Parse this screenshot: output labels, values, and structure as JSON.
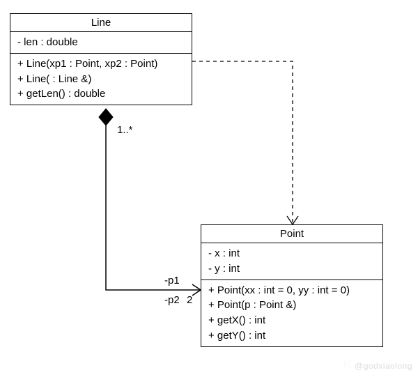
{
  "classes": {
    "line": {
      "name": "Line",
      "attributes": [
        "- len : double"
      ],
      "operations": [
        "+ Line(xp1 : Point, xp2 : Point)",
        "+ Line( : Line &)",
        "+ getLen() : double"
      ]
    },
    "point": {
      "name": "Point",
      "attributes": [
        "- x : int",
        "- y : int"
      ],
      "operations": [
        "+ Point(xx : int = 0, yy : int = 0)",
        "+ Point(p : Point &)",
        "+ getX() : int",
        "+ getY() : int"
      ]
    }
  },
  "labels": {
    "mult_line_side": "1..*",
    "role_p1": "-p1",
    "role_p2": "-p2",
    "mult_point_side": "2"
  },
  "watermark": "@godxiaolong"
}
